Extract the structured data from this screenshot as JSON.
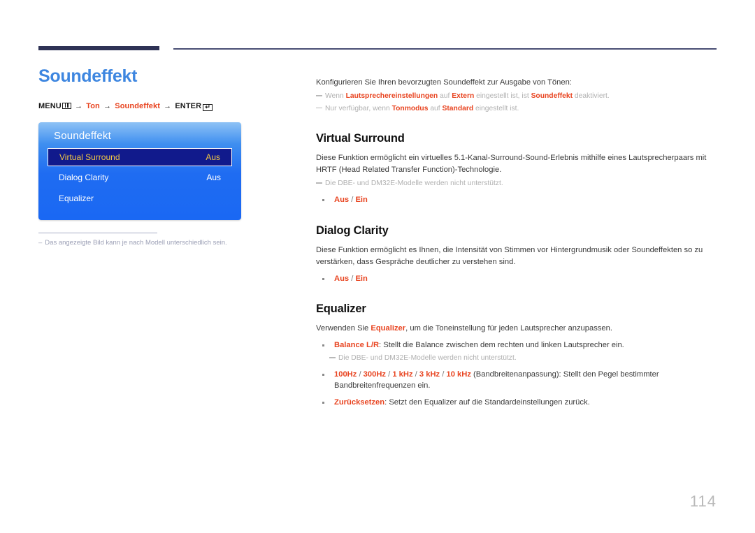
{
  "header": {
    "rule_color": "#2e3255"
  },
  "left": {
    "page_title": "Soundeffekt",
    "breadcrumb": {
      "menu_label": "MENU",
      "menu_icon": "menu-bars-icon",
      "arrow": "→",
      "item1": "Ton",
      "item2": "Soundeffekt",
      "enter_label": "ENTER",
      "enter_icon": "enter-return-icon",
      "enter_glyph": "↵"
    },
    "osd": {
      "title": "Soundeffekt",
      "rows": [
        {
          "label": "Virtual Surround",
          "value": "Aus",
          "selected": true
        },
        {
          "label": "Dialog Clarity",
          "value": "Aus",
          "selected": false
        },
        {
          "label": "Equalizer",
          "value": "",
          "selected": false
        }
      ]
    },
    "footnote": {
      "dash": "‒",
      "text": "Das angezeigte Bild kann je nach Modell unterschiedlich sein."
    }
  },
  "right": {
    "intro": {
      "lead": "Konfigurieren Sie Ihren bevorzugten Soundeffekt zur Ausgabe von Tönen:",
      "note1": {
        "pre": "Wenn ",
        "term1": "Lautsprechereinstellungen",
        "mid1": " auf ",
        "term2": "Extern",
        "mid2": " eingestellt ist, ist ",
        "term3": "Soundeffekt",
        "post": " deaktiviert."
      },
      "note2": {
        "pre": "Nur verfügbar, wenn ",
        "term1": "Tonmodus",
        "mid1": " auf ",
        "term2": "Standard",
        "post": " eingestellt ist."
      }
    },
    "sections": [
      {
        "heading": "Virtual Surround",
        "paragraph": "Diese Funktion ermöglicht ein virtuelles 5.1-Kanal-Surround-Sound-Erlebnis mithilfe eines Lautsprecherpaars mit HRTF (Head Related Transfer Function)-Technologie.",
        "note": "Die DBE- und DM32E-Modelle werden nicht unterstützt.",
        "option_a": "Aus",
        "option_sep": " / ",
        "option_b": "Ein"
      },
      {
        "heading": "Dialog Clarity",
        "paragraph": "Diese Funktion ermöglicht es Ihnen, die Intensität von Stimmen vor Hintergrundmusik oder Soundeffekten so zu verstärken, dass Gespräche deutlicher zu verstehen sind.",
        "option_a": "Aus",
        "option_sep": " / ",
        "option_b": "Ein"
      }
    ],
    "equalizer": {
      "heading": "Equalizer",
      "lead_pre": "Verwenden Sie ",
      "lead_term": "Equalizer",
      "lead_post": ", um die Toneinstellung für jeden Lautsprecher anzupassen.",
      "balance": {
        "term": "Balance L/R",
        "text": ": Stellt die Balance zwischen dem rechten und linken Lautsprecher ein."
      },
      "balance_note": "Die DBE- und DM32E-Modelle werden nicht unterstützt.",
      "bands": {
        "b1": "100Hz",
        "b2": "300Hz",
        "b3": "1 kHz",
        "b4": "3 kHz",
        "b5": "10 kHz",
        "sep": " / ",
        "text": " (Bandbreitenanpassung): Stellt den Pegel bestimmter Bandbreitenfrequenzen ein."
      },
      "reset": {
        "term": "Zurücksetzen",
        "text": ": Setzt den Equalizer auf die Standardeinstellungen zurück."
      }
    }
  },
  "footer": {
    "page_number": "114"
  }
}
